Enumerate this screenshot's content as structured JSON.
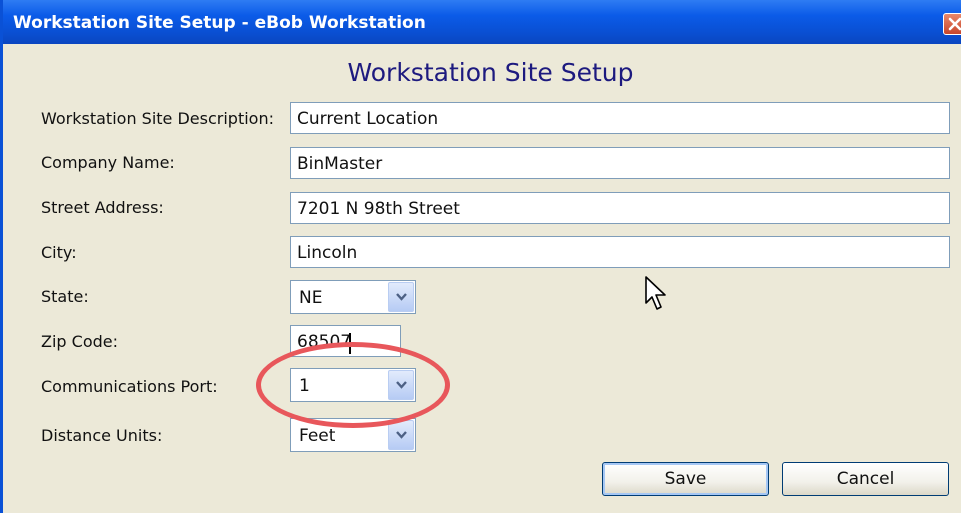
{
  "window": {
    "title": "Workstation Site Setup - eBob Workstation",
    "close_icon": "close-icon"
  },
  "form": {
    "heading": "Workstation Site Setup",
    "fields": {
      "site_description": {
        "label": "Workstation Site Description:",
        "value": "Current Location"
      },
      "company_name": {
        "label": "Company Name:",
        "value": "BinMaster"
      },
      "street_address": {
        "label": "Street Address:",
        "value": "7201 N 98th Street"
      },
      "city": {
        "label": "City:",
        "value": "Lincoln"
      },
      "state": {
        "label": "State:",
        "value": "NE"
      },
      "zip_code": {
        "label": "Zip Code:",
        "value": "68507"
      },
      "communications_port": {
        "label": "Communications Port:",
        "value": "1"
      },
      "distance_units": {
        "label": "Distance Units:",
        "value": "Feet"
      }
    }
  },
  "buttons": {
    "save": "Save",
    "cancel": "Cancel"
  },
  "colors": {
    "title_bar": "#0a4fd2",
    "heading": "#1d1a7f",
    "highlight_circle": "#e8575b",
    "dialog_background": "#ece9d8"
  }
}
